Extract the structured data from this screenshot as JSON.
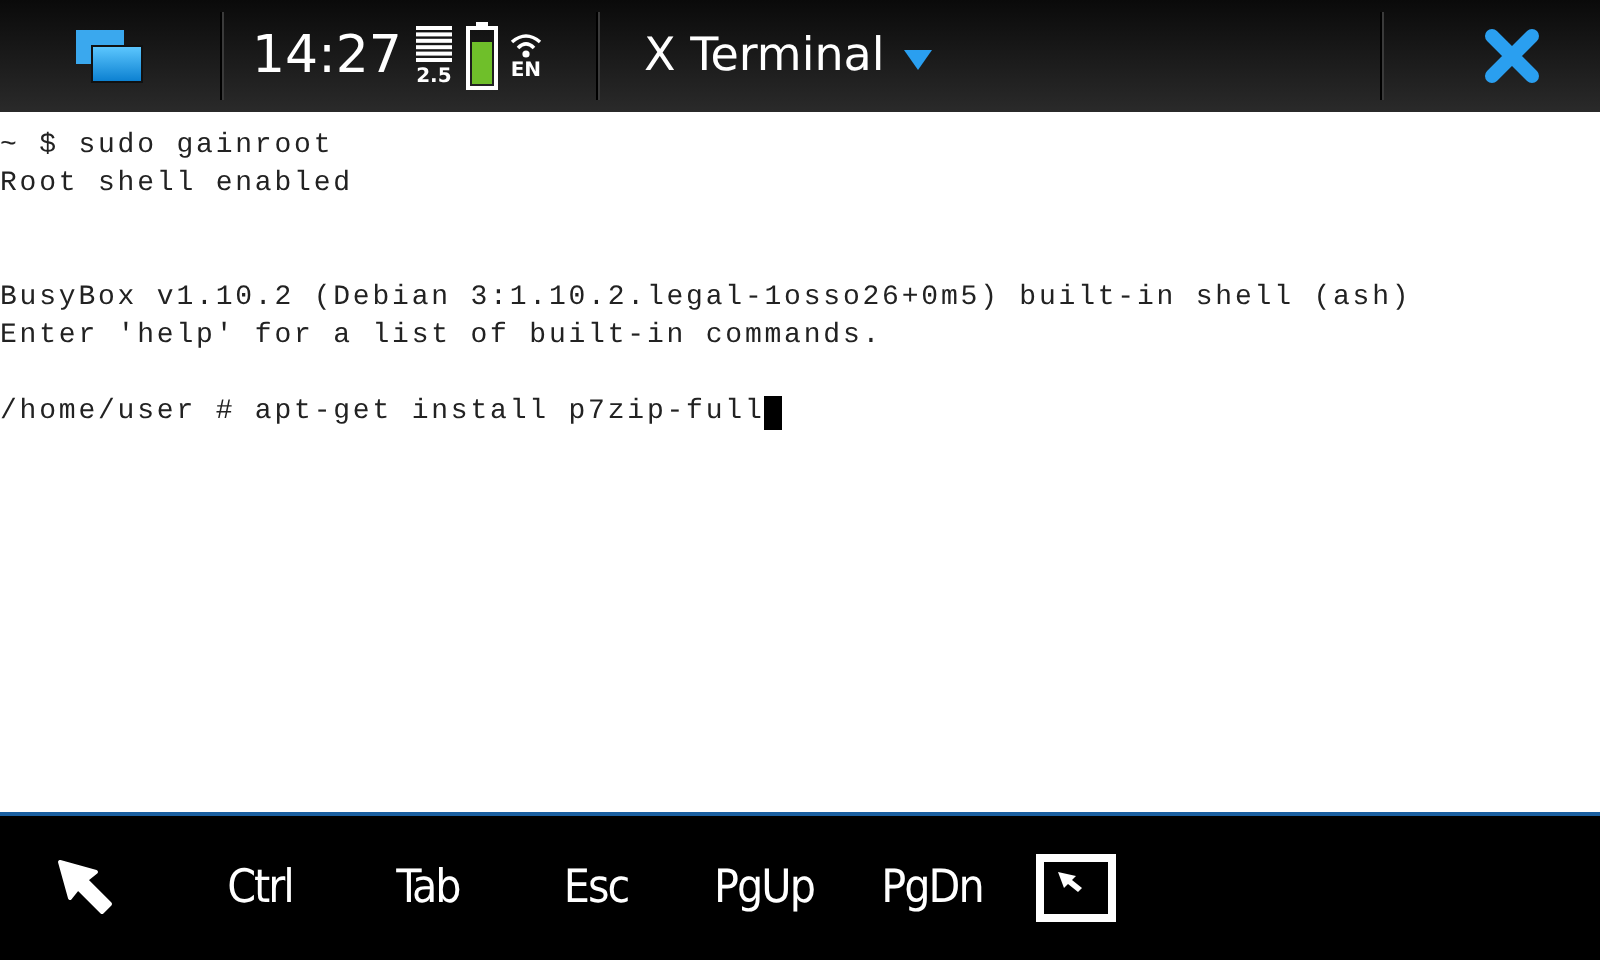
{
  "status_bar": {
    "time": "14:27",
    "network_label": "2.5",
    "language": "EN",
    "app_title": "X Terminal"
  },
  "terminal": {
    "lines": [
      {
        "kind": "text",
        "text": "~ $ sudo gainroot"
      },
      {
        "kind": "text",
        "text": "Root shell enabled"
      },
      {
        "kind": "blank"
      },
      {
        "kind": "blank"
      },
      {
        "kind": "text",
        "text": "BusyBox v1.10.2 (Debian 3:1.10.2.legal-1osso26+0m5) built-in shell (ash)"
      },
      {
        "kind": "text",
        "text": "Enter 'help' for a list of built-in commands."
      },
      {
        "kind": "blank"
      },
      {
        "kind": "text",
        "text": "/home/user # apt-get install p7zip-full",
        "cursor": true
      }
    ]
  },
  "toolbar": {
    "keys": [
      {
        "kind": "pointer"
      },
      {
        "kind": "key",
        "label": "Ctrl"
      },
      {
        "kind": "key",
        "label": "Tab"
      },
      {
        "kind": "key",
        "label": "Esc"
      },
      {
        "kind": "key",
        "label": "PgUp"
      },
      {
        "kind": "key",
        "label": "PgDn"
      },
      {
        "kind": "fullscreen"
      }
    ]
  }
}
